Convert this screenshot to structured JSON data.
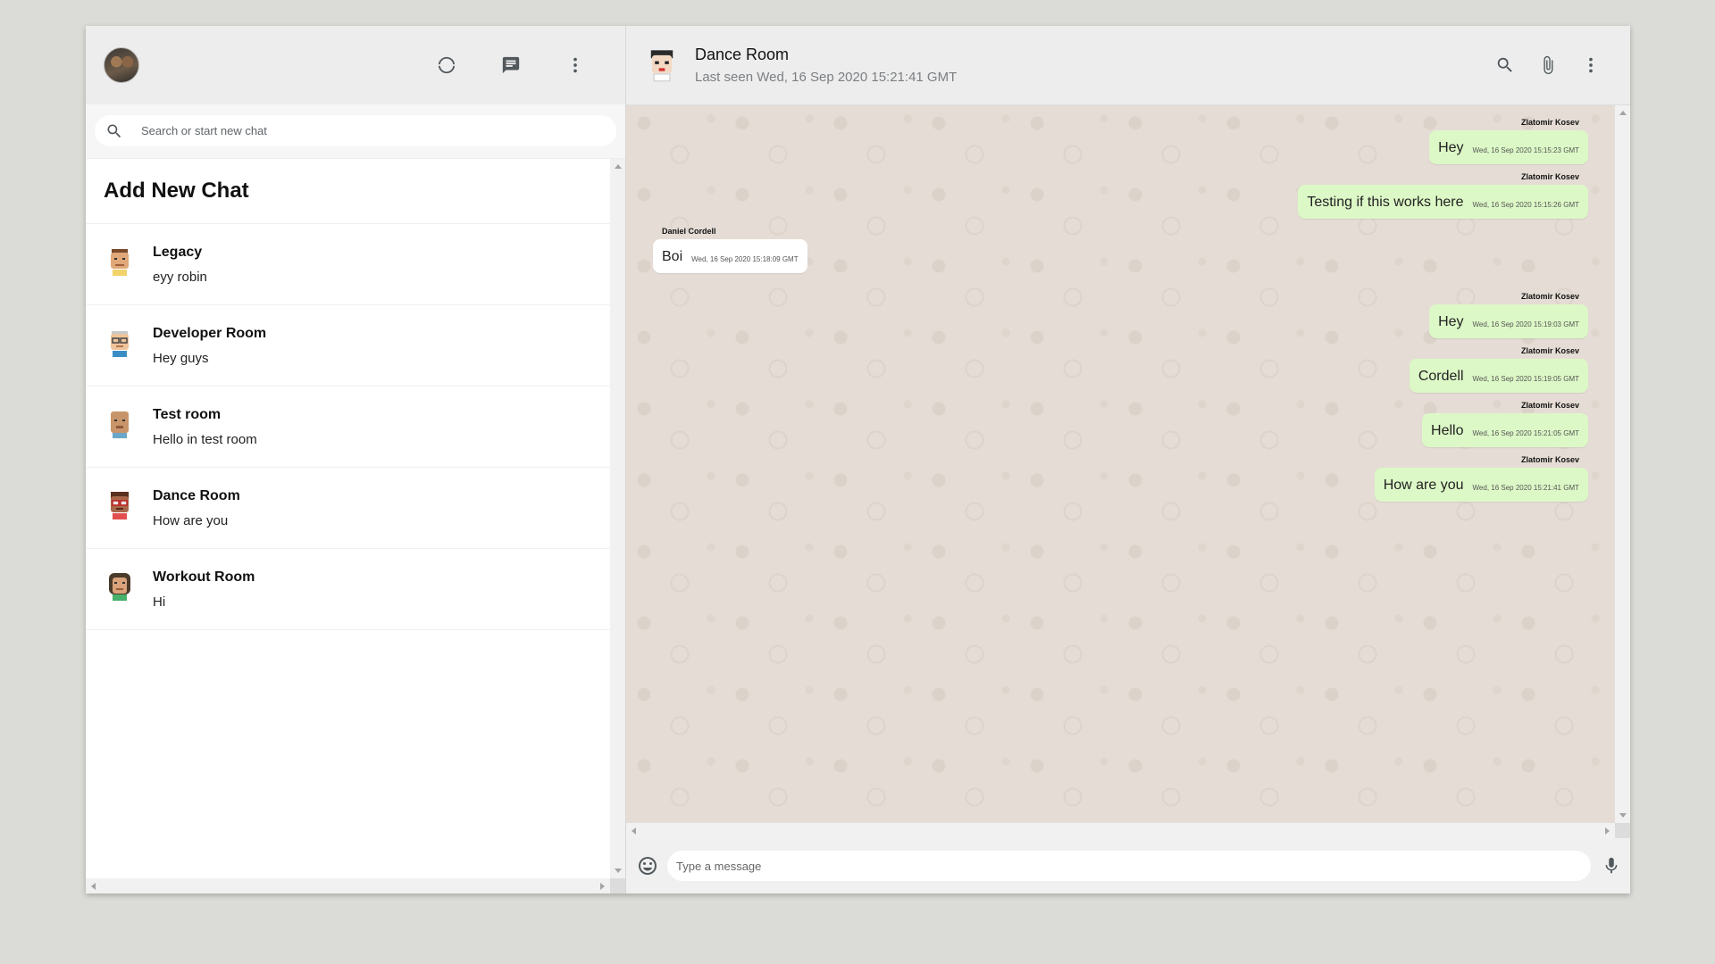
{
  "sidebar": {
    "search_placeholder": "Search or start new chat",
    "add_new_chat": "Add New Chat",
    "chats": [
      {
        "name": "Legacy",
        "last_message": "eyy robin"
      },
      {
        "name": "Developer Room",
        "last_message": "Hey guys"
      },
      {
        "name": "Test room",
        "last_message": "Hello in test room"
      },
      {
        "name": "Dance Room",
        "last_message": "How are you"
      },
      {
        "name": "Workout Room",
        "last_message": "Hi"
      }
    ]
  },
  "chat": {
    "room_name": "Dance Room",
    "last_seen": "Last seen Wed, 16 Sep 2020 15:21:41 GMT",
    "messages": [
      {
        "direction": "out",
        "sender": "Zlatomir Kosev",
        "text": "Hey",
        "time": "Wed, 16 Sep 2020 15:15:23 GMT"
      },
      {
        "direction": "out",
        "sender": "Zlatomir Kosev",
        "text": "Testing if this works here",
        "time": "Wed, 16 Sep 2020 15:15:26 GMT"
      },
      {
        "direction": "in",
        "sender": "Daniel Cordell",
        "text": "Boi",
        "time": "Wed, 16 Sep 2020 15:18:09 GMT"
      },
      {
        "direction": "out",
        "sender": "Zlatomir Kosev",
        "text": "Hey",
        "time": "Wed, 16 Sep 2020 15:19:03 GMT"
      },
      {
        "direction": "out",
        "sender": "Zlatomir Kosev",
        "text": "Cordell",
        "time": "Wed, 16 Sep 2020 15:19:05 GMT"
      },
      {
        "direction": "out",
        "sender": "Zlatomir Kosev",
        "text": "Hello",
        "time": "Wed, 16 Sep 2020 15:21:05 GMT"
      },
      {
        "direction": "out",
        "sender": "Zlatomir Kosev",
        "text": "How are you",
        "time": "Wed, 16 Sep 2020 15:21:41 GMT"
      }
    ],
    "input_placeholder": "Type a message"
  },
  "colors": {
    "page_background": "#dbdcd7",
    "header_background": "#ededed",
    "chat_background": "#e5ddd5",
    "outgoing_bubble": "#dcf8c6",
    "incoming_bubble": "#ffffff",
    "icon_color": "#51585c"
  },
  "icons": {
    "header": [
      "status-icon",
      "new-chat-icon",
      "menu-icon"
    ],
    "chat_header": [
      "search-icon",
      "attach-icon",
      "menu-icon"
    ],
    "footer": [
      "emoji-icon",
      "microphone-icon"
    ]
  }
}
